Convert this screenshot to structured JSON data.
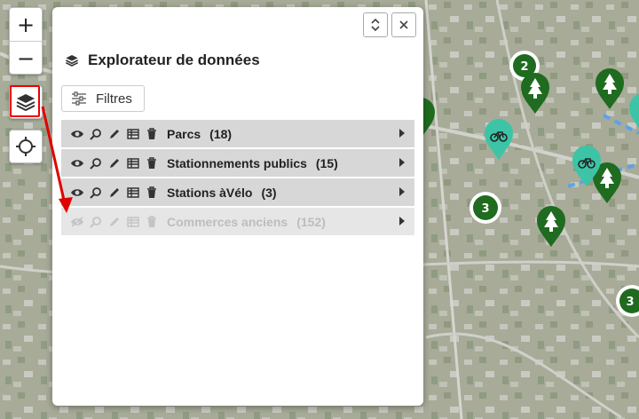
{
  "map": {
    "clusters": [
      {
        "label": "2",
        "kind": "cluster"
      },
      {
        "label": "3",
        "kind": "cluster"
      },
      {
        "label": "3",
        "kind": "cluster"
      }
    ],
    "colors": {
      "park": "#1f6b1f",
      "bike": "#3dc4a6",
      "route": "#5aa3ea"
    }
  },
  "controls": {
    "zoom_in": "+",
    "zoom_out": "−",
    "layers_icon": "layers-icon",
    "locate_icon": "crosshair-icon"
  },
  "panel": {
    "title": "Explorateur de données",
    "filters_label": "Filtres",
    "layers": [
      {
        "name": "Parcs",
        "count": "(18)",
        "enabled": true
      },
      {
        "name": "Stationnements publics",
        "count": "(15)",
        "enabled": true
      },
      {
        "name": "Stations àVélo",
        "count": "(3)",
        "enabled": true
      },
      {
        "name": "Commerces anciens",
        "count": "(152)",
        "enabled": false
      }
    ]
  },
  "annotation": {
    "color": "#e00000"
  }
}
